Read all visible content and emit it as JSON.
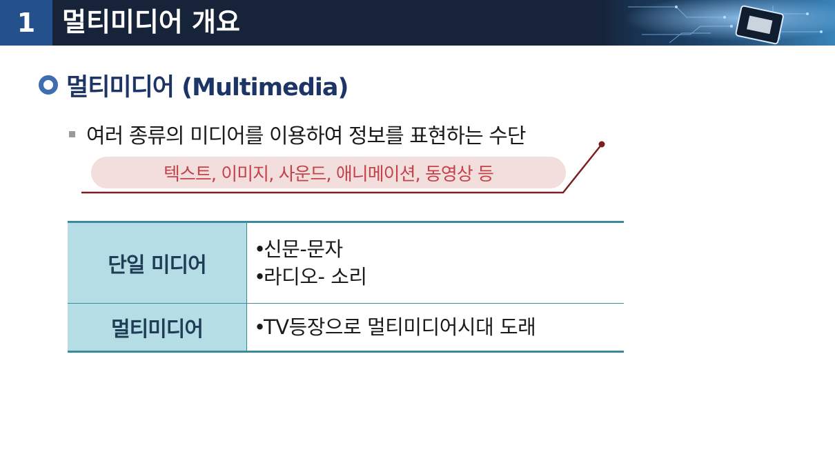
{
  "header": {
    "number": "1",
    "title": "멀티미디어 개요"
  },
  "section": {
    "heading": "멀티미디어 (Multimedia)"
  },
  "bullet": {
    "text": "여러 종류의 미디어를 이용하여 정보를 표현하는 수단"
  },
  "callout": {
    "text": "텍스트, 이미지, 사운드, 애니메이션, 동영상 등"
  },
  "table": {
    "rows": [
      {
        "label": "단일 미디어",
        "items": [
          "신문-문자",
          "라디오- 소리"
        ]
      },
      {
        "label": "멀티미디어",
        "items": [
          "TV등장으로 멀티미디어시대 도래"
        ]
      }
    ]
  },
  "colors": {
    "header_bg": "#162338",
    "header_number_bg": "#24508c",
    "heading_text": "#1d3566",
    "callout_text": "#c4434a",
    "callout_bg": "#f3dede",
    "callout_line": "#7a1f24",
    "table_label_bg": "#b5dde6",
    "table_border": "#3a8a9c"
  },
  "bullet_glyph": "•",
  "icons": [
    "ring-bullet-icon",
    "square-bullet-icon",
    "circuit-chip-graphic"
  ]
}
